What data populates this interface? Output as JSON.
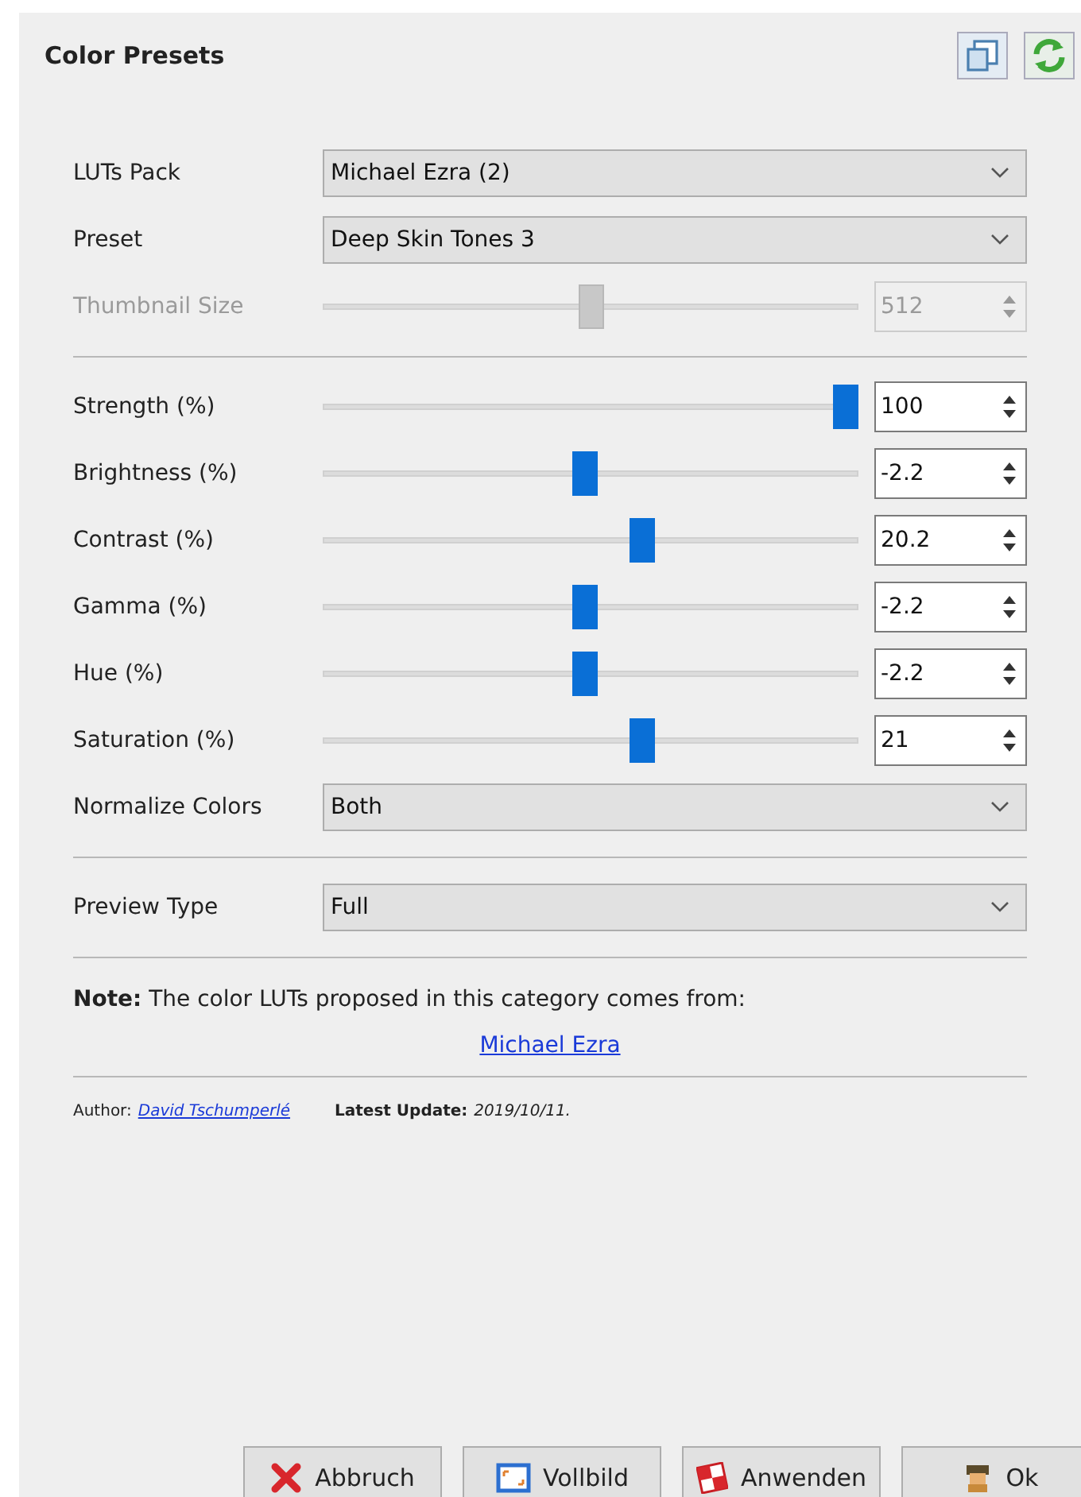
{
  "panel": {
    "title": "Color Presets"
  },
  "sections": [
    [
      {
        "kind": "dropdown",
        "label": "LUTs Pack",
        "value": "Michael Ezra (2)"
      },
      {
        "kind": "dropdown",
        "label": "Preset",
        "value": "Deep Skin Tones 3"
      },
      {
        "kind": "slider",
        "label": "Thumbnail Size",
        "level": 0.5,
        "value": "512",
        "disabled": true
      }
    ],
    [
      {
        "kind": "slider",
        "label": "Strength (%)",
        "level": 1,
        "value": "100",
        "disabled": false
      },
      {
        "kind": "slider",
        "label": "Brightness (%)",
        "level": 0.49,
        "value": "-2.2",
        "disabled": false
      },
      {
        "kind": "slider",
        "label": "Contrast (%)",
        "level": 0.6,
        "value": "20.2",
        "disabled": false
      },
      {
        "kind": "slider",
        "label": "Gamma (%)",
        "level": 0.49,
        "value": "-2.2",
        "disabled": false
      },
      {
        "kind": "slider",
        "label": "Hue (%)",
        "level": 0.49,
        "value": "-2.2",
        "disabled": false
      },
      {
        "kind": "slider",
        "label": "Saturation (%)",
        "level": 0.6,
        "value": "21",
        "disabled": false
      },
      {
        "kind": "dropdown",
        "label": "Normalize Colors",
        "value": "Both"
      }
    ],
    [
      {
        "kind": "dropdown",
        "label": "Preview Type",
        "value": "Full"
      }
    ]
  ],
  "note": {
    "text": "**Note:** The color LUTs proposed in this category comes from:",
    "link": "Michael Ezra"
  },
  "footer": {
    "author_label": "Author:",
    "author": "David Tschumperlé",
    "update_label": "Latest Update:",
    "update": "2019/10/11."
  },
  "buttons": [
    {
      "kind": "cancel",
      "label": "Abbruch"
    },
    {
      "kind": "fullscreen",
      "label": "Vollbild"
    },
    {
      "kind": "apply",
      "label": "Anwenden"
    },
    {
      "kind": "ok",
      "label": "Ok"
    }
  ]
}
